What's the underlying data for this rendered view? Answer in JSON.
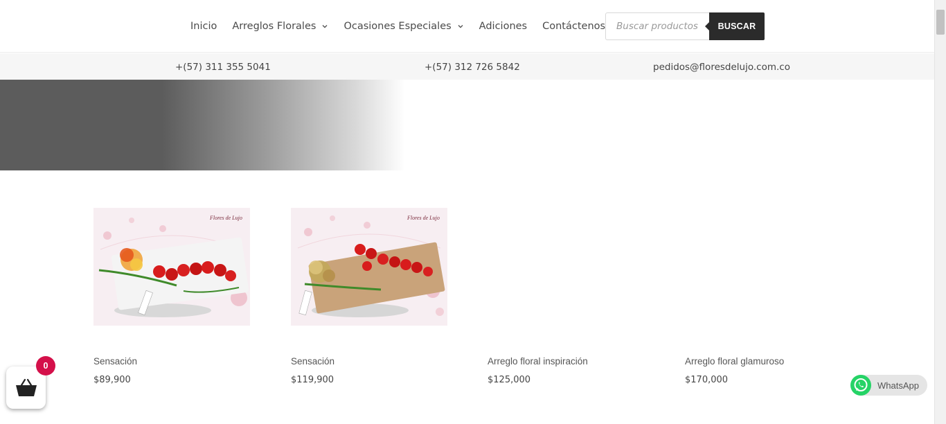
{
  "nav": {
    "items": [
      {
        "label": "Inicio",
        "has_dropdown": false
      },
      {
        "label": "Arreglos Florales",
        "has_dropdown": true
      },
      {
        "label": "Ocasiones Especiales",
        "has_dropdown": true
      },
      {
        "label": "Adiciones",
        "has_dropdown": false
      },
      {
        "label": "Contáctenos",
        "has_dropdown": false
      }
    ]
  },
  "search": {
    "placeholder": "Buscar productos",
    "button_label": "BUSCAR"
  },
  "contact": {
    "phone1": "+(57) 311 355 5041",
    "phone2": "+(57) 312 726 5842",
    "email": "pedidos@floresdelujo.com.co"
  },
  "products": [
    {
      "name": "Sensación",
      "price": "$89,900",
      "image": "white-box-roses"
    },
    {
      "name": "Sensación",
      "price": "$119,900",
      "image": "kraft-box-roses"
    },
    {
      "name": "Arreglo floral inspiración",
      "price": "$125,000",
      "image": ""
    },
    {
      "name": "Arreglo floral glamuroso",
      "price": "$170,000",
      "image": ""
    }
  ],
  "cart": {
    "count": "0"
  },
  "whatsapp": {
    "label": "WhatsApp"
  },
  "colors": {
    "accent_dark": "#2b2b2b",
    "badge": "#d4104a",
    "whatsapp_green": "#25d366"
  }
}
